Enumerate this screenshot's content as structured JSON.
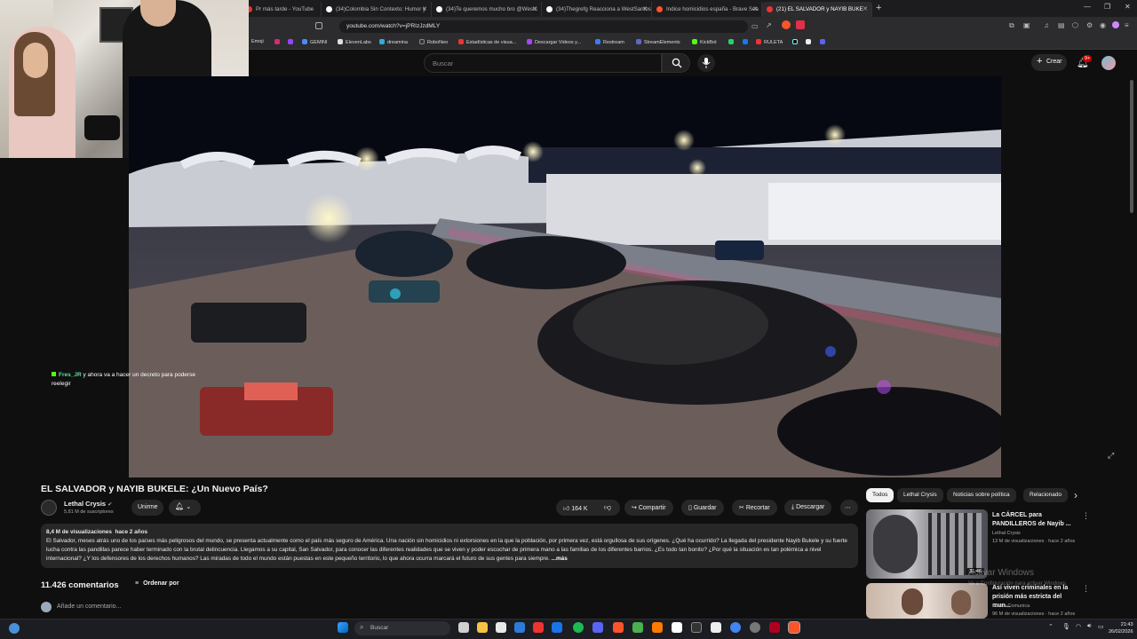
{
  "browser": {
    "tabs": [
      {
        "label": "Pr más tarde - YouTube"
      },
      {
        "label": "(34)Colombia Sin Contexto: Humor y"
      },
      {
        "label": "(34)Te queremos mucho bro @Westc"
      },
      {
        "label": "(34)Thegrefg Reacciona a WestSantos"
      },
      {
        "label": "Indice homicidios españa - Brave Sea"
      },
      {
        "label": "(21) EL SALVADOR y NAYIB BUKE"
      }
    ],
    "url": "youtube.com/watch?v=jPRIzJzdMLY",
    "bookmarks": [
      "Emoji",
      "GEMINI",
      "ElevenLabs",
      "dreamina",
      "RoboNeo",
      "Estadísticas de visua...",
      "Descargar Videos y...",
      "Restream",
      "StreamElements",
      "KickBot",
      "RULETA"
    ],
    "accent": "#fb542b"
  },
  "youtube": {
    "search_placeholder": "Buscar",
    "create_label": "Crear",
    "notif_count": "9+"
  },
  "overlay": {
    "chat_user": "Fres_JR",
    "chat_text": "y ahora va a hacer un decreto para poderse reelegir"
  },
  "video": {
    "title": "EL SALVADOR y NAYIB BUKELE: ¿Un Nuevo País?",
    "channel": "Lethal Crysis",
    "subscribers": "5,81 M de suscriptores",
    "join_label": "Unirme",
    "likes": "164 K",
    "share_label": "Compartir",
    "save_label": "Guardar",
    "clip_label": "Recortar",
    "download_label": "Descargar",
    "views": "8,4 M de visualizaciones",
    "age": "hace 2 años",
    "description": "El Salvador, meses atrás uno de los países más peligrosos del mundo, se presenta actualmente como el país más seguro de América. Una nación sin homicidios ni extorsiones en la que la población, por primera vez, está orgullosa de sus orígenes. ¿Qué ha ocurrido? La llegada del presidente Nayib Bukele y su fuerte lucha contra las pandillas parece haber terminado con la brutal delincuencia. Llegamos a su capital, San Salvador, para conocer las diferentes realidades que se viven y poder escuchar de primera mano a las familias de los diferentes barrios. ¿Es todo tan bonito? ¿Por qué la situación es tan polémica a nivel internacional? ¿Y los defensores de los derechos humanos? Las miradas de todo el mundo están puestas en este pequeño territorio, lo que ahora ocurra marcará el futuro de sus gentes para siempre.",
    "more_label": "...más"
  },
  "comments": {
    "count_label": "11.426 comentarios",
    "sort_label": "Ordenar por",
    "add_placeholder": "Añade un comentario..."
  },
  "chips": [
    "Todos",
    "Lethal Crysis",
    "Noticias sobre política",
    "Relacionado"
  ],
  "related": [
    {
      "title": "La CÁRCEL para PANDILLEROS de Nayib ...",
      "channel": "Lethal Crysis",
      "meta": "13 M de visualizaciones · hace 2 años",
      "duration": "31:46"
    },
    {
      "title": "Así viven criminales en la prisión más estricta del mun...",
      "channel": "Luisito Comunica",
      "meta": "96 M de visualizaciones · hace 2 años",
      "duration": ""
    }
  ],
  "windows": {
    "watermark_title": "Activar Windows",
    "watermark_sub": "Ve a Configuración para activar Windows.",
    "search_label": "Buscar",
    "time": "21:43",
    "date": "26/02/2026"
  }
}
